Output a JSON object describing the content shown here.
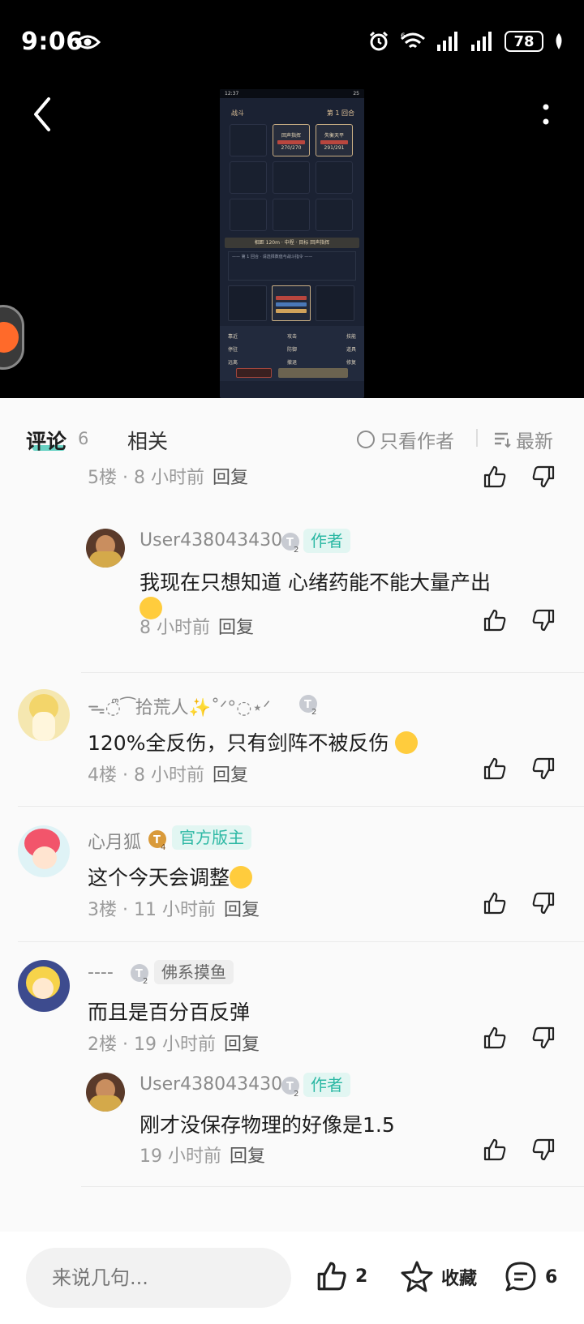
{
  "status": {
    "time": "9:06",
    "battery": "78",
    "wifi_label": "6"
  },
  "video": {
    "phone_time": "12:37",
    "phone_battery": "25",
    "title": "战斗",
    "round": "第 1 回合",
    "unit1_name": "回声指挥",
    "unit1_hp": "270/270",
    "unit2_name": "失衡天平",
    "unit2_hp": "291/291",
    "info": "相距 120m · 中程 · 目标 回声指挥",
    "log": "—— 第 1 回合 · 请选择数值与战斗指令 ——",
    "self_hp": "241/310",
    "self_mp": "200/200",
    "menu_row1": [
      "靠近",
      "攻击",
      "技能"
    ],
    "menu_row2": [
      "停驻",
      "防御",
      "道具"
    ],
    "menu_row3": [
      "远离",
      "撤退",
      "修复"
    ],
    "btn_escape": "逃跑",
    "btn_confirm": "结束回合"
  },
  "tabs": {
    "comments": "评论",
    "comments_count": "6",
    "related": "相关",
    "author_only": "只看作者",
    "sort": "最新"
  },
  "comments": [
    {
      "meta_floor": "5楼 · 8 小时前",
      "reply": "回复"
    },
    {
      "user": "User438043430",
      "level": "2",
      "tag": "作者",
      "text_line1": "我现在只想知道  心绪药能不能大量产出",
      "time": "8 小时前",
      "reply": "回复"
    },
    {
      "user": "ᯓ◌ᩨ⁀拾荒人✨˚ᐟ°◌⋆ᐟ",
      "level": "2",
      "text": "120%全反伤，只有剑阵不被反伤",
      "meta": "4楼 · 8 小时前",
      "reply": "回复"
    },
    {
      "user": "心月狐",
      "level": "4",
      "tag": "官方版主",
      "text": "这个今天会调整",
      "meta": "3楼 · 11 小时前",
      "reply": "回复"
    },
    {
      "user": "----",
      "level": "2",
      "tag": "佛系摸鱼",
      "text": "而且是百分百反弹",
      "meta": "2楼 · 19 小时前",
      "reply": "回复"
    },
    {
      "user": "User438043430",
      "level": "2",
      "tag": "作者",
      "text": "刚才没保存物理的好像是1.5",
      "time": "19 小时前",
      "reply": "回复"
    }
  ],
  "bottom": {
    "input_placeholder": "来说几句...",
    "likes": "2",
    "favorite": "收藏",
    "comments": "6"
  },
  "colors": {
    "accent": "#38c5b2",
    "tag_bg": "#e2f6f2"
  }
}
